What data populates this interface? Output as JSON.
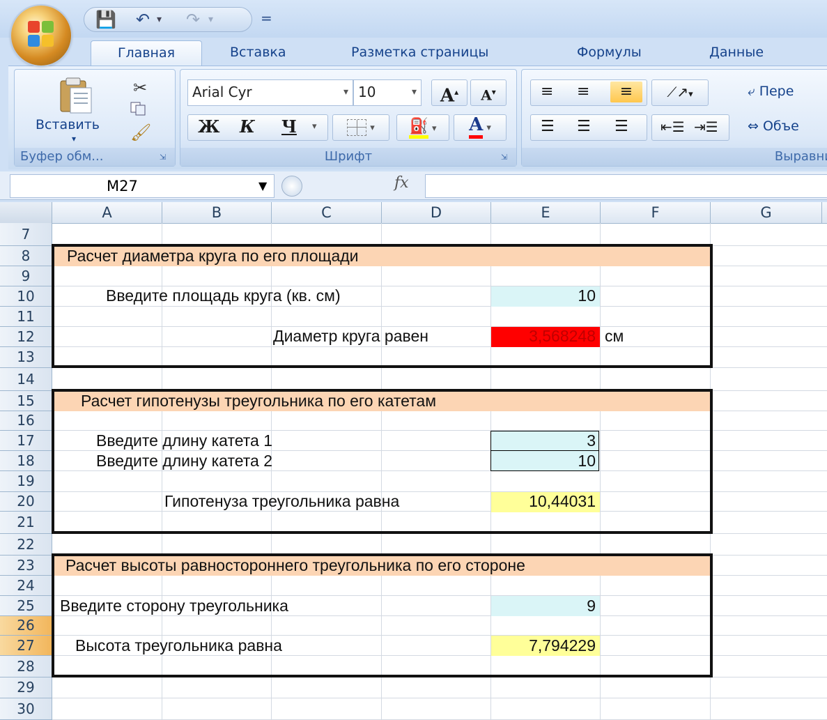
{
  "quick_access": {
    "save_icon": "save-icon",
    "undo_icon": "undo-icon",
    "redo_icon": "redo-icon",
    "customize": "="
  },
  "tabs": [
    "Главная",
    "Вставка",
    "Разметка страницы",
    "Формулы",
    "Данные"
  ],
  "ribbon": {
    "clipboard": {
      "paste_label": "Вставить",
      "group_label": "Буфер обм..."
    },
    "font": {
      "font_name": "Arial Cyr",
      "font_size": "10",
      "bold": "Ж",
      "italic": "К",
      "underline": "Ч",
      "grow": "A",
      "shrink": "A",
      "font_color_letter": "A",
      "group_label": "Шрифт"
    },
    "alignment": {
      "wrap_label": "Пере",
      "merge_label": "Объе",
      "group_label": "Выравни"
    }
  },
  "formula_bar": {
    "cell_ref": "M27",
    "fx": "fx"
  },
  "columns": [
    "A",
    "B",
    "C",
    "D",
    "E",
    "F",
    "G"
  ],
  "rows": [
    "7",
    "8",
    "9",
    "10",
    "11",
    "12",
    "13",
    "14",
    "15",
    "16",
    "17",
    "18",
    "19",
    "20",
    "21",
    "22",
    "23",
    "24",
    "25",
    "26",
    "27",
    "28",
    "29",
    "30"
  ],
  "selected_row": "27",
  "sheet": {
    "circle": {
      "title": "Расчет диаметра круга по его площади",
      "area_label": "Введите площадь круга (кв. см)",
      "area_value": "10",
      "diameter_label": "Диаметр круга равен",
      "diameter_value": "3,568248",
      "unit": "см"
    },
    "hyp": {
      "title": "Расчет гипотенузы треугольника по его катетам",
      "leg1_label": "Введите длину катета 1",
      "leg1_value": "3",
      "leg2_label": "Введите длину катета 2",
      "leg2_value": "10",
      "result_label": "Гипотенуза треугольника равна",
      "result_value": "10,44031"
    },
    "height": {
      "title": "Расчет высоты равностороннего треугольника по его стороне",
      "side_label": "Введите сторону треугольника",
      "side_value": "9",
      "result_label": "Высота треугольника равна",
      "result_value": "7,794229"
    }
  },
  "colors": {
    "title_band": "#fcd5b4",
    "input_fill": "#daf5f7",
    "result_red": "#ff0000",
    "result_yellow": "#ffff99"
  }
}
